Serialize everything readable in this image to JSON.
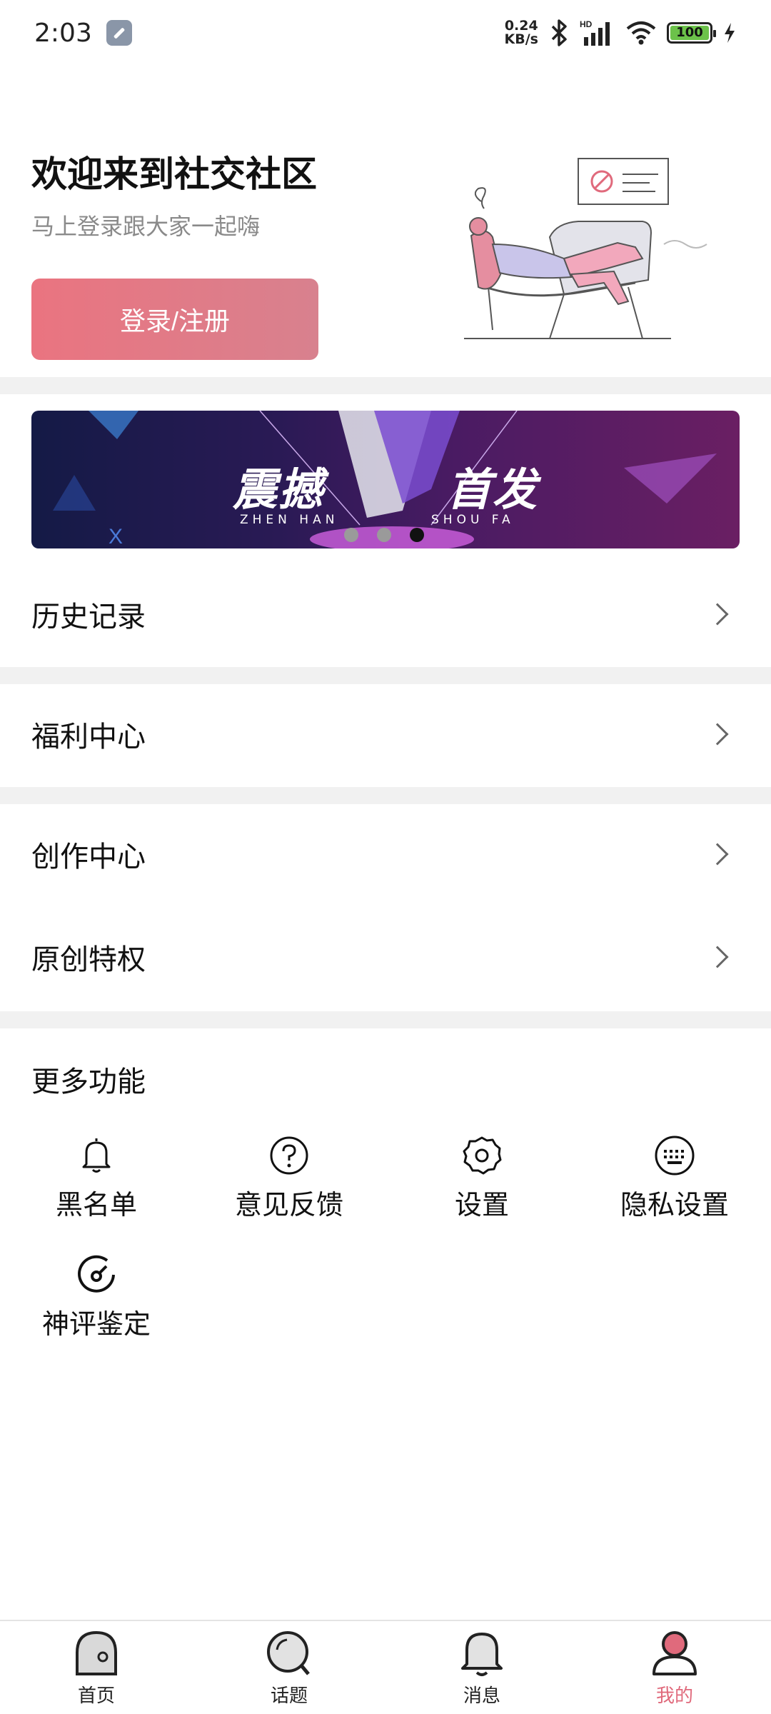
{
  "status_bar": {
    "time": "2:03",
    "net_speed_value": "0.24",
    "net_speed_unit": "KB/s",
    "signal_label": "HD",
    "battery": "100"
  },
  "welcome": {
    "title": "欢迎来到社交社区",
    "subtitle": "马上登录跟大家一起嗨",
    "login_button": "登录/注册"
  },
  "banner": {
    "title_left": "震撼",
    "title_right": "首发",
    "sub_left": "ZHEN HAN",
    "sub_right": "SHOU FA",
    "slide_count": 3,
    "active_slide": 3
  },
  "menu": {
    "history": "历史记录",
    "welfare": "福利中心",
    "creation": "创作中心",
    "original": "原创特权"
  },
  "more": {
    "title": "更多功能",
    "items": [
      {
        "label": "黑名单",
        "icon": "bell-icon"
      },
      {
        "label": "意见反馈",
        "icon": "question-icon"
      },
      {
        "label": "设置",
        "icon": "gear-icon"
      },
      {
        "label": "隐私设置",
        "icon": "keyboard-icon"
      },
      {
        "label": "神评鉴定",
        "icon": "gauge-icon"
      }
    ]
  },
  "bottom_nav": {
    "items": [
      {
        "label": "首页",
        "icon": "home-icon"
      },
      {
        "label": "话题",
        "icon": "topic-icon"
      },
      {
        "label": "消息",
        "icon": "message-icon"
      },
      {
        "label": "我的",
        "icon": "profile-icon",
        "active": true
      }
    ]
  },
  "colors": {
    "accent": "#e06a7c",
    "login_gradient_start": "#ea7480",
    "login_gradient_end": "#d8818e",
    "divider": "#f1f1f1"
  }
}
